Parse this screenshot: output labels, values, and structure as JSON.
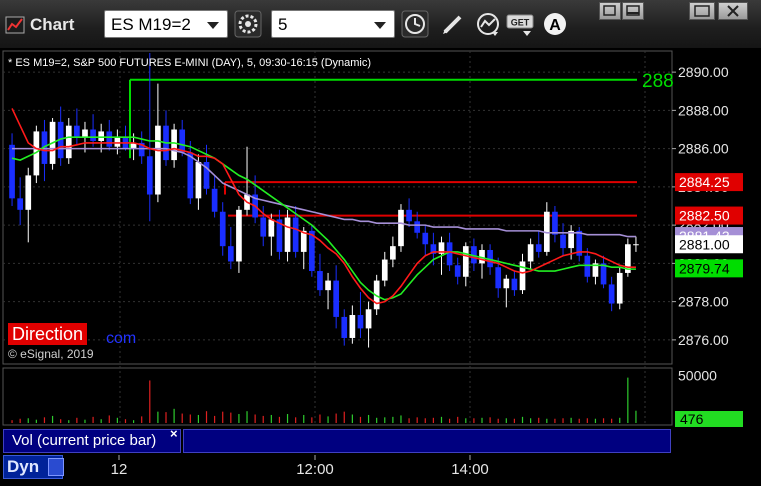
{
  "toolbar": {
    "app_title": "Chart",
    "symbol_value": "ES M19=2",
    "interval_value": "5",
    "icons": [
      "gear-icon",
      "clock-icon",
      "pencil-icon",
      "study-icon",
      "get-icon",
      "font-icon",
      "restore-icon",
      "minimize-icon",
      "maximize-icon",
      "close-icon"
    ]
  },
  "chart": {
    "header": "* ES M19=2, S&P 500 FUTURES E-MINI (DAY), 5, 09:30-16:15 (Dynamic)",
    "price_axis": [
      "2890.00",
      "2888.00",
      "2886.00",
      "2884.00",
      "2882.00",
      "2880.00",
      "2878.00",
      "2876.00"
    ],
    "level_green": "2889.6",
    "level_green_label": "288",
    "price_badges": [
      {
        "label": "2884.25",
        "bg": "#e00000",
        "fg": "#ffffff"
      },
      {
        "label": "2882.50",
        "bg": "#e00000",
        "fg": "#ffffff"
      },
      {
        "label": "2881.43",
        "bg": "#a58fd6",
        "fg": "#ffffff"
      },
      {
        "label": "2881.00",
        "bg": "#ffffff",
        "fg": "#000000"
      },
      {
        "label": "2879.74",
        "bg": "#00dd00",
        "fg": "#000000"
      }
    ],
    "time_axis": [
      "12",
      "12:00",
      "14:00"
    ],
    "volume_axis": [
      "50000"
    ],
    "volume_badge": "476",
    "volume_caption": "Vol (current price bar)",
    "dyn_label": "Dyn",
    "copyright": "© eSignal, 2019",
    "logo_left": "Direction",
    "logo_right": "com",
    "colors": {
      "up": "#ffffff",
      "down": "#1a2eff",
      "ema_fast": "#ff1a1a",
      "ema_slow": "#22ee22",
      "vwap": "#a58fd6",
      "level_red": "#e00000",
      "level_green": "#00dd00"
    }
  },
  "chart_data": {
    "type": "candlestick",
    "ylim": [
      2875.0,
      2891.0
    ],
    "levels": [
      {
        "price": 2889.6,
        "color": "green"
      },
      {
        "price": 2884.25,
        "color": "red"
      },
      {
        "price": 2882.5,
        "color": "red"
      }
    ],
    "last_price": 2881.0,
    "candles": [
      [
        2886.2,
        2886.8,
        2883.0,
        2883.4
      ],
      [
        2883.4,
        2884.5,
        2882.0,
        2882.8
      ],
      [
        2882.8,
        2885.0,
        2881.1,
        2884.6
      ],
      [
        2884.6,
        2887.2,
        2884.2,
        2886.9
      ],
      [
        2886.9,
        2887.5,
        2884.3,
        2885.2
      ],
      [
        2885.2,
        2887.6,
        2884.9,
        2887.4
      ],
      [
        2887.4,
        2888.2,
        2885.1,
        2885.5
      ],
      [
        2885.5,
        2887.6,
        2885.2,
        2887.2
      ],
      [
        2887.2,
        2888.1,
        2886.2,
        2886.6
      ],
      [
        2886.6,
        2887.4,
        2885.8,
        2887.0
      ],
      [
        2887.0,
        2887.8,
        2886.1,
        2886.4
      ],
      [
        2886.4,
        2887.3,
        2885.8,
        2886.9
      ],
      [
        2886.9,
        2887.5,
        2885.9,
        2886.1
      ],
      [
        2886.1,
        2887.0,
        2885.7,
        2886.6
      ],
      [
        2886.6,
        2887.2,
        2885.9,
        2886.0
      ],
      [
        2886.0,
        2886.8,
        2885.4,
        2886.3
      ],
      [
        2886.3,
        2886.9,
        2885.2,
        2885.6
      ],
      [
        2885.6,
        2891.0,
        2882.2,
        2883.6
      ],
      [
        2883.6,
        2889.4,
        2883.2,
        2887.2
      ],
      [
        2887.2,
        2888.0,
        2885.1,
        2885.4
      ],
      [
        2885.4,
        2887.3,
        2885.0,
        2887.0
      ],
      [
        2887.0,
        2887.5,
        2885.6,
        2885.8
      ],
      [
        2885.8,
        2886.4,
        2883.1,
        2883.4
      ],
      [
        2883.4,
        2885.7,
        2882.8,
        2885.3
      ],
      [
        2885.3,
        2886.2,
        2883.6,
        2883.9
      ],
      [
        2883.9,
        2884.6,
        2882.4,
        2882.7
      ],
      [
        2882.7,
        2883.2,
        2880.4,
        2880.9
      ],
      [
        2880.9,
        2881.9,
        2879.7,
        2880.1
      ],
      [
        2880.1,
        2883.0,
        2879.5,
        2882.8
      ],
      [
        2882.8,
        2886.1,
        2882.5,
        2883.6
      ],
      [
        2883.6,
        2884.6,
        2882.1,
        2882.4
      ],
      [
        2882.4,
        2883.0,
        2880.9,
        2881.4
      ],
      [
        2881.4,
        2882.6,
        2880.4,
        2882.3
      ],
      [
        2882.3,
        2882.8,
        2880.2,
        2880.6
      ],
      [
        2880.6,
        2882.8,
        2880.1,
        2882.4
      ],
      [
        2882.4,
        2883.0,
        2880.3,
        2880.6
      ],
      [
        2880.6,
        2881.9,
        2879.7,
        2881.7
      ],
      [
        2881.7,
        2882.0,
        2879.3,
        2879.6
      ],
      [
        2879.6,
        2880.5,
        2878.3,
        2878.6
      ],
      [
        2878.6,
        2879.5,
        2877.6,
        2879.1
      ],
      [
        2879.1,
        2879.9,
        2876.6,
        2877.2
      ],
      [
        2877.2,
        2877.6,
        2875.7,
        2876.1
      ],
      [
        2876.1,
        2877.8,
        2875.8,
        2877.3
      ],
      [
        2877.3,
        2878.5,
        2876.1,
        2876.6
      ],
      [
        2876.6,
        2878.0,
        2875.6,
        2877.6
      ],
      [
        2877.6,
        2879.4,
        2877.3,
        2879.1
      ],
      [
        2879.1,
        2880.6,
        2878.8,
        2880.2
      ],
      [
        2880.2,
        2881.4,
        2879.8,
        2880.9
      ],
      [
        2880.9,
        2883.1,
        2880.6,
        2882.8
      ],
      [
        2882.8,
        2883.4,
        2881.9,
        2882.2
      ],
      [
        2882.2,
        2882.7,
        2881.3,
        2881.6
      ],
      [
        2881.6,
        2882.0,
        2880.4,
        2881.0
      ],
      [
        2881.0,
        2881.6,
        2879.9,
        2880.5
      ],
      [
        2880.5,
        2881.4,
        2879.4,
        2881.1
      ],
      [
        2881.1,
        2881.6,
        2879.6,
        2879.9
      ],
      [
        2879.9,
        2880.3,
        2878.9,
        2879.3
      ],
      [
        2879.3,
        2881.1,
        2878.8,
        2880.9
      ],
      [
        2880.9,
        2881.3,
        2879.6,
        2880.0
      ],
      [
        2880.0,
        2881.0,
        2879.2,
        2880.7
      ],
      [
        2880.7,
        2881.0,
        2879.4,
        2879.8
      ],
      [
        2879.8,
        2880.3,
        2878.2,
        2878.7
      ],
      [
        2878.7,
        2879.4,
        2877.7,
        2879.2
      ],
      [
        2879.2,
        2879.6,
        2878.3,
        2878.6
      ],
      [
        2878.6,
        2880.5,
        2878.4,
        2880.1
      ],
      [
        2880.1,
        2881.3,
        2879.7,
        2881.0
      ],
      [
        2881.0,
        2881.7,
        2880.3,
        2880.6
      ],
      [
        2880.6,
        2883.2,
        2880.4,
        2882.7
      ],
      [
        2882.7,
        2883.0,
        2881.1,
        2881.5
      ],
      [
        2881.5,
        2882.1,
        2880.4,
        2880.8
      ],
      [
        2880.8,
        2882.0,
        2880.2,
        2881.7
      ],
      [
        2881.7,
        2881.9,
        2880.1,
        2880.4
      ],
      [
        2880.4,
        2880.8,
        2879.0,
        2879.3
      ],
      [
        2879.3,
        2880.2,
        2878.9,
        2880.0
      ],
      [
        2880.0,
        2880.4,
        2878.7,
        2878.9
      ],
      [
        2878.9,
        2879.3,
        2877.5,
        2877.9
      ],
      [
        2877.9,
        2879.8,
        2877.6,
        2879.5
      ],
      [
        2879.5,
        2881.3,
        2879.3,
        2881.0
      ],
      [
        2881.0,
        2881.4,
        2880.6,
        2881.0
      ]
    ],
    "ema_fast": [
      2888.1,
      2887.2,
      2886.3,
      2886.0,
      2885.9,
      2885.9,
      2886.1,
      2886.1,
      2886.2,
      2886.3,
      2886.3,
      2886.3,
      2886.3,
      2886.3,
      2886.3,
      2886.3,
      2886.2,
      2886.0,
      2885.9,
      2885.9,
      2886.0,
      2885.9,
      2885.8,
      2885.6,
      2885.6,
      2885.5,
      2885.2,
      2884.4,
      2883.6,
      2883.2,
      2883.0,
      2882.6,
      2882.3,
      2882.1,
      2881.9,
      2881.8,
      2881.6,
      2881.5,
      2881.2,
      2880.8,
      2880.5,
      2880.0,
      2879.3,
      2878.7,
      2878.2,
      2877.9,
      2878.0,
      2878.3,
      2878.8,
      2879.4,
      2880.0,
      2880.4,
      2880.6,
      2880.6,
      2880.6,
      2880.5,
      2880.4,
      2880.3,
      2880.2,
      2880.1,
      2880.0,
      2879.8,
      2879.6,
      2879.5,
      2879.6,
      2879.8,
      2880.0,
      2880.2,
      2880.4,
      2880.5,
      2880.6,
      2880.6,
      2880.5,
      2880.3,
      2880.1,
      2879.9,
      2879.8,
      2879.8
    ],
    "ema_slow": [
      2885.5,
      2885.4,
      2885.6,
      2885.8,
      2886.1,
      2886.3,
      2886.5,
      2886.6,
      2886.6,
      2886.6,
      2886.6,
      2886.6,
      2886.6,
      2886.6,
      2886.6,
      2886.6,
      2886.5,
      2886.4,
      2886.4,
      2886.3,
      2886.3,
      2886.2,
      2886.1,
      2885.9,
      2885.7,
      2885.5,
      2885.2,
      2884.9,
      2884.6,
      2884.4,
      2884.1,
      2883.8,
      2883.5,
      2883.2,
      2882.9,
      2882.6,
      2882.3,
      2882.0,
      2881.6,
      2881.2,
      2880.7,
      2880.2,
      2879.6,
      2879.0,
      2878.6,
      2878.3,
      2878.1,
      2878.2,
      2878.4,
      2878.9,
      2879.4,
      2879.8,
      2880.2,
      2880.4,
      2880.6,
      2880.6,
      2880.5,
      2880.4,
      2880.3,
      2880.2,
      2880.1,
      2880.0,
      2879.9,
      2879.8,
      2879.7,
      2879.6,
      2879.6,
      2879.6,
      2879.7,
      2879.8,
      2879.9,
      2879.9,
      2879.9,
      2879.9,
      2879.8,
      2879.8,
      2879.7,
      2879.7
    ],
    "vwap": [
      2886.0,
      2886.0,
      2886.0,
      2886.0,
      2886.0,
      2886.0,
      2886.0,
      2886.0,
      2886.0,
      2886.0,
      2886.0,
      2886.0,
      2886.0,
      2886.0,
      2886.0,
      2886.0,
      2886.0,
      2886.0,
      2886.0,
      2886.0,
      2885.9,
      2885.8,
      2885.6,
      2885.3,
      2885.0,
      2884.6,
      2884.2,
      2884.0,
      2883.8,
      2883.6,
      2883.4,
      2883.3,
      2883.2,
      2883.1,
      2883.0,
      2882.9,
      2882.8,
      2882.7,
      2882.6,
      2882.5,
      2882.4,
      2882.3,
      2882.3,
      2882.2,
      2882.2,
      2882.1,
      2882.1,
      2882.1,
      2882.1,
      2882.0,
      2882.0,
      2882.0,
      2881.9,
      2881.9,
      2881.9,
      2881.9,
      2881.8,
      2881.8,
      2881.8,
      2881.8,
      2881.8,
      2881.7,
      2881.7,
      2881.7,
      2881.7,
      2881.7,
      2881.6,
      2881.6,
      2881.6,
      2881.6,
      2881.6,
      2881.5,
      2881.5,
      2881.5,
      2881.5,
      2881.5,
      2881.4,
      2881.4
    ],
    "volume": [
      3000,
      4500,
      5000,
      3500,
      6000,
      7500,
      4000,
      3000,
      5500,
      3500,
      6500,
      4000,
      8000,
      5500,
      4000,
      3000,
      7000,
      45000,
      12000,
      11500,
      15000,
      10000,
      9000,
      8500,
      12500,
      7500,
      12000,
      11000,
      9500,
      12500,
      9000,
      7500,
      8500,
      6500,
      9500,
      6000,
      8500,
      6000,
      9000,
      7000,
      10000,
      12000,
      9000,
      6500,
      8500,
      5500,
      6000,
      6500,
      8000,
      5000,
      6000,
      5000,
      5500,
      6500,
      4500,
      6500,
      5000,
      5000,
      5500,
      6000,
      4500,
      5000,
      4500,
      6500,
      5000,
      5500,
      4500,
      4500,
      5000,
      5500,
      4500,
      5000,
      4500,
      5000,
      4500,
      5500,
      48000,
      13000
    ],
    "volume_ylim": [
      0,
      55000
    ]
  }
}
